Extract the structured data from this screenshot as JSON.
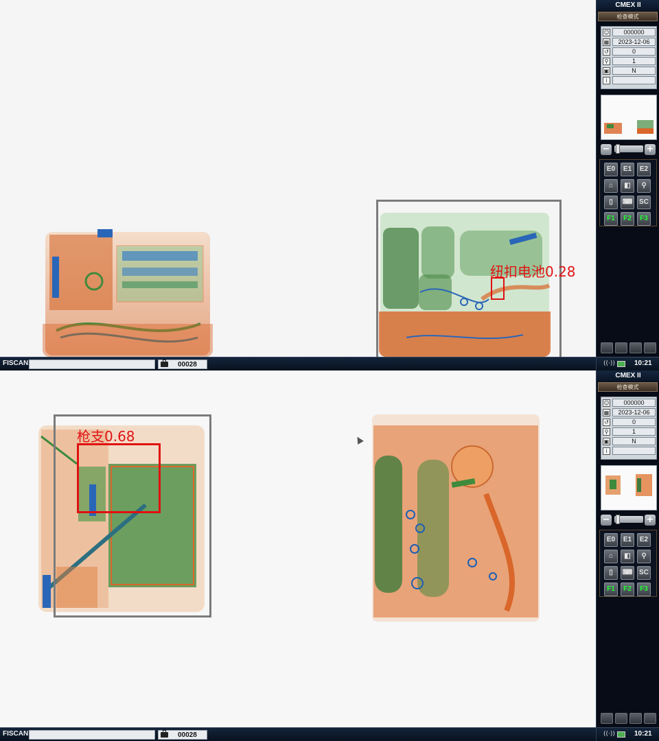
{
  "panels": [
    {
      "detections": [
        {
          "label": "纽扣电池0.28",
          "color": "#e01010"
        }
      ],
      "status": {
        "brand": "FISCAN",
        "field_value": "",
        "count": "00028"
      },
      "sidebar": {
        "title": "CMEX II",
        "mode": "检查模式",
        "info": [
          {
            "icon": "operator-icon",
            "value": "000000"
          },
          {
            "icon": "calendar-icon",
            "value": "2023-12-06"
          },
          {
            "icon": "counter-icon",
            "value": "0"
          },
          {
            "icon": "zoom-icon",
            "value": "1"
          },
          {
            "icon": "suitcase-icon",
            "value": "N"
          },
          {
            "icon": "info-icon",
            "value": ""
          }
        ],
        "keys": [
          "E0",
          "E1",
          "E2",
          "home-icon",
          "contrast-icon",
          "magnify-icon",
          "book-icon",
          "keyboard-icon",
          "SC",
          "F1",
          "F2",
          "F3"
        ],
        "time": "10:21"
      }
    },
    {
      "detections": [
        {
          "label": "枪支0.68",
          "color": "#e01010"
        }
      ],
      "status": {
        "brand": "FISCAN",
        "field_value": "",
        "count": "00028"
      },
      "sidebar": {
        "title": "CMEX II",
        "mode": "检查模式",
        "info": [
          {
            "icon": "operator-icon",
            "value": "000000"
          },
          {
            "icon": "calendar-icon",
            "value": "2023-12-06"
          },
          {
            "icon": "counter-icon",
            "value": "0"
          },
          {
            "icon": "zoom-icon",
            "value": "1"
          },
          {
            "icon": "suitcase-icon",
            "value": "N"
          },
          {
            "icon": "info-icon",
            "value": ""
          }
        ],
        "keys": [
          "E0",
          "E1",
          "E2",
          "home-icon",
          "contrast-icon",
          "magnify-icon",
          "book-icon",
          "keyboard-icon",
          "SC",
          "F1",
          "F2",
          "F3"
        ],
        "time": "10:21"
      }
    }
  ],
  "colors": {
    "orange": "#d9662a",
    "green": "#3f8a3c",
    "blue": "#1d5fb5",
    "detection": "#e01010"
  }
}
